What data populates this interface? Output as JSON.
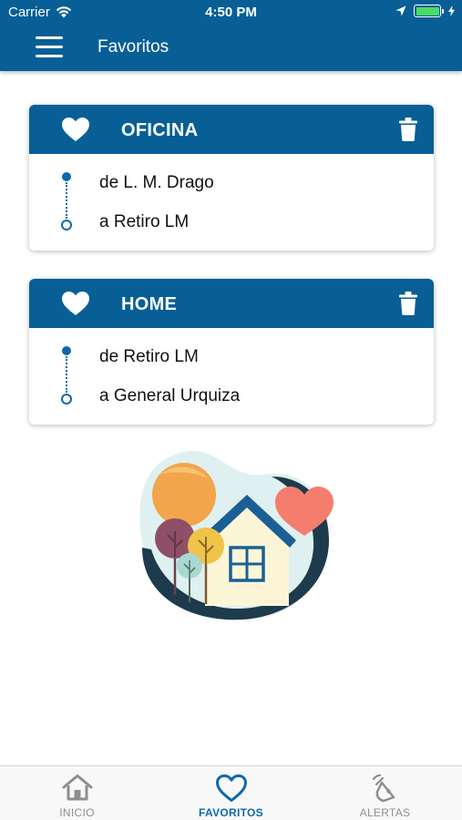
{
  "status_bar": {
    "carrier": "Carrier",
    "time": "4:50 PM",
    "battery_level": 1.0
  },
  "nav": {
    "title": "Favoritos",
    "menu_icon": "hamburger-icon"
  },
  "favorites": [
    {
      "name": "OFICINA",
      "from": "de L. M. Drago",
      "to": "a Retiro LM"
    },
    {
      "name": "HOME",
      "from": "de Retiro LM",
      "to": "a General Urquiza"
    }
  ],
  "tabs": [
    {
      "label": "INICIO",
      "icon": "home-icon",
      "active": false
    },
    {
      "label": "FAVORITOS",
      "icon": "heart-icon",
      "active": true
    },
    {
      "label": "ALERTAS",
      "icon": "alert-icon",
      "active": false
    }
  ],
  "colors": {
    "primary": "#075f96",
    "accent": "#0d69ab",
    "battery": "#4cd964"
  }
}
